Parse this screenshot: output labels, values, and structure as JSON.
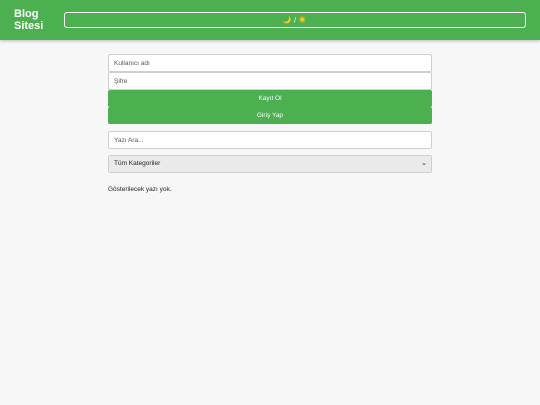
{
  "header": {
    "brand_line1": "Blog",
    "brand_line2": "Sitesi",
    "theme_toggle_label": "🌙 / ☀️",
    "background_color": "#4caf50"
  },
  "auth": {
    "username_placeholder": "Kullanıcı adı",
    "password_placeholder": "Şifre",
    "register_label": "Kayıt Ol",
    "login_label": "Giriş Yap"
  },
  "search": {
    "placeholder": "Yazı Ara..."
  },
  "category_filter": {
    "selected": "Tüm Kategoriler",
    "icon": "chevron-down-icon"
  },
  "posts": {
    "empty_message": "Gösterilecek yazı yok."
  }
}
